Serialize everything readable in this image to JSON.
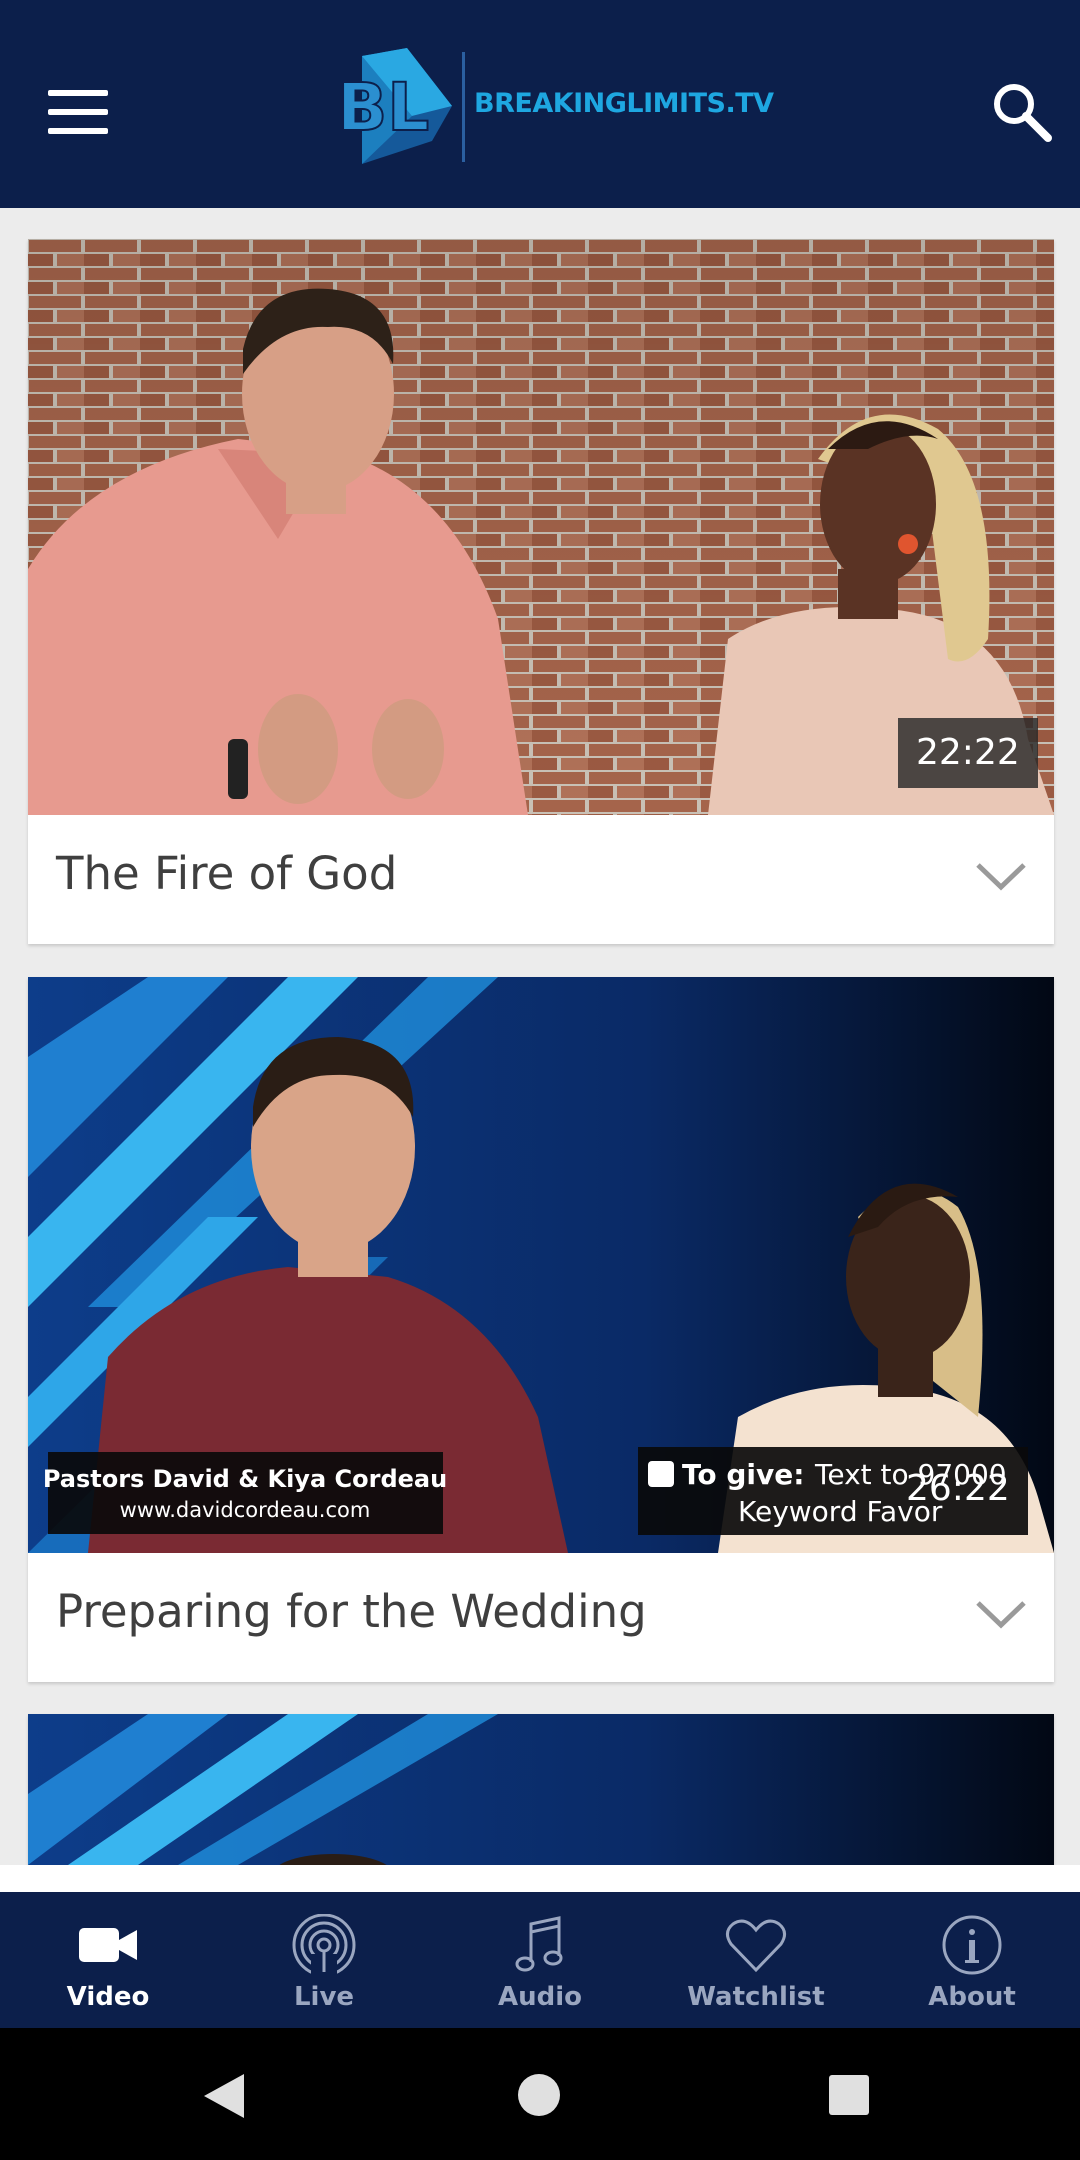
{
  "header": {
    "logo_text": "BREAKINGLIMITS.TV",
    "logo_monogram": "BL",
    "menu_icon": "hamburger-menu-icon",
    "search_icon": "search-icon"
  },
  "videos": [
    {
      "title": "The Fire of God",
      "duration": "22:22"
    },
    {
      "title": "Preparing for the Wedding",
      "duration": "26:22",
      "lower_third": {
        "names": "Pastors David & Kiya Cordeau",
        "website": "www.davidcordeau.com",
        "give_prefix": "To give:",
        "give_text": "Text to 97000",
        "keyword": "Keyword Favor"
      }
    }
  ],
  "bottom_nav": {
    "active": "Video",
    "items": [
      {
        "label": "Video",
        "icon": "video-camera-icon"
      },
      {
        "label": "Live",
        "icon": "live-broadcast-icon"
      },
      {
        "label": "Audio",
        "icon": "music-note-icon"
      },
      {
        "label": "Watchlist",
        "icon": "heart-icon"
      },
      {
        "label": "About",
        "icon": "info-icon"
      }
    ]
  },
  "colors": {
    "header_bg": "#0c1f4b",
    "accent": "#1ea7e1",
    "nav_inactive": "#9aa6c0"
  }
}
